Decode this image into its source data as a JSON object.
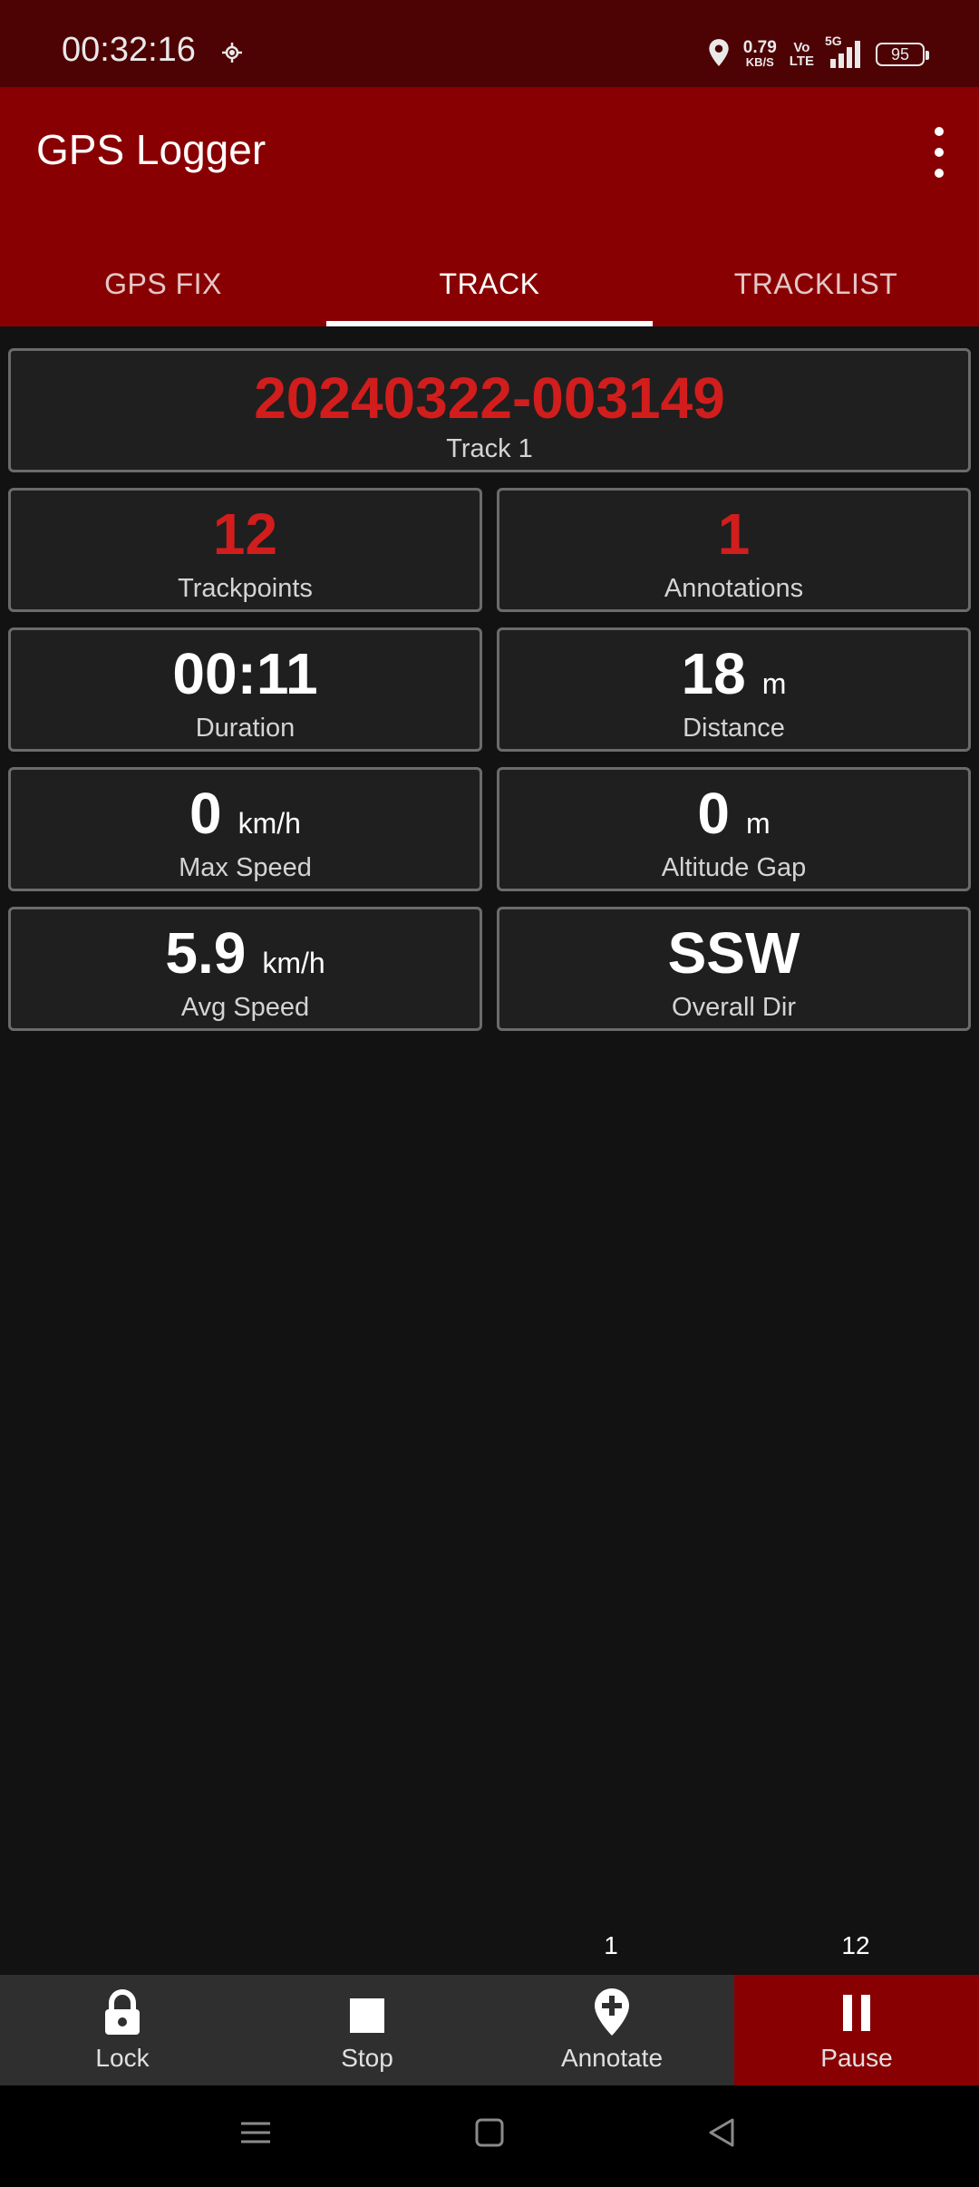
{
  "status_bar": {
    "time": "00:32:16",
    "net_speed": "0.79",
    "net_unit": "KB/S",
    "volte_top": "Vo",
    "volte_bottom": "LTE",
    "network": "5G",
    "battery": "95"
  },
  "app_bar": {
    "title": "GPS Logger",
    "menu_icon": "more-vert-icon"
  },
  "tabs": [
    {
      "label": "GPS FIX",
      "active": false
    },
    {
      "label": "TRACK",
      "active": true
    },
    {
      "label": "TRACKLIST",
      "active": false
    }
  ],
  "track": {
    "name": "20240322-003149",
    "label": "Track 1"
  },
  "stats": {
    "trackpoints": {
      "value": "12",
      "label": "Trackpoints"
    },
    "annotations": {
      "value": "1",
      "label": "Annotations"
    },
    "duration": {
      "value": "00:11",
      "label": "Duration"
    },
    "distance": {
      "value": "18",
      "unit": "m",
      "label": "Distance"
    },
    "max_speed": {
      "value": "0",
      "unit": "km/h",
      "label": "Max Speed"
    },
    "altitude_gap": {
      "value": "0",
      "unit": "m",
      "label": "Altitude Gap"
    },
    "avg_speed": {
      "value": "5.9",
      "unit": "km/h",
      "label": "Avg Speed"
    },
    "overall_dir": {
      "value": "SSW",
      "label": "Overall Dir"
    }
  },
  "counts": {
    "annotate": "1",
    "pause": "12"
  },
  "actions": [
    {
      "label": "Lock",
      "icon": "lock-icon"
    },
    {
      "label": "Stop",
      "icon": "stop-icon"
    },
    {
      "label": "Annotate",
      "icon": "add-location-icon"
    },
    {
      "label": "Pause",
      "icon": "pause-icon",
      "active": true
    }
  ],
  "colors": {
    "status_bar": "#4d0204",
    "primary": "#890002",
    "accent_text": "#d21d1d",
    "background": "#121212"
  }
}
